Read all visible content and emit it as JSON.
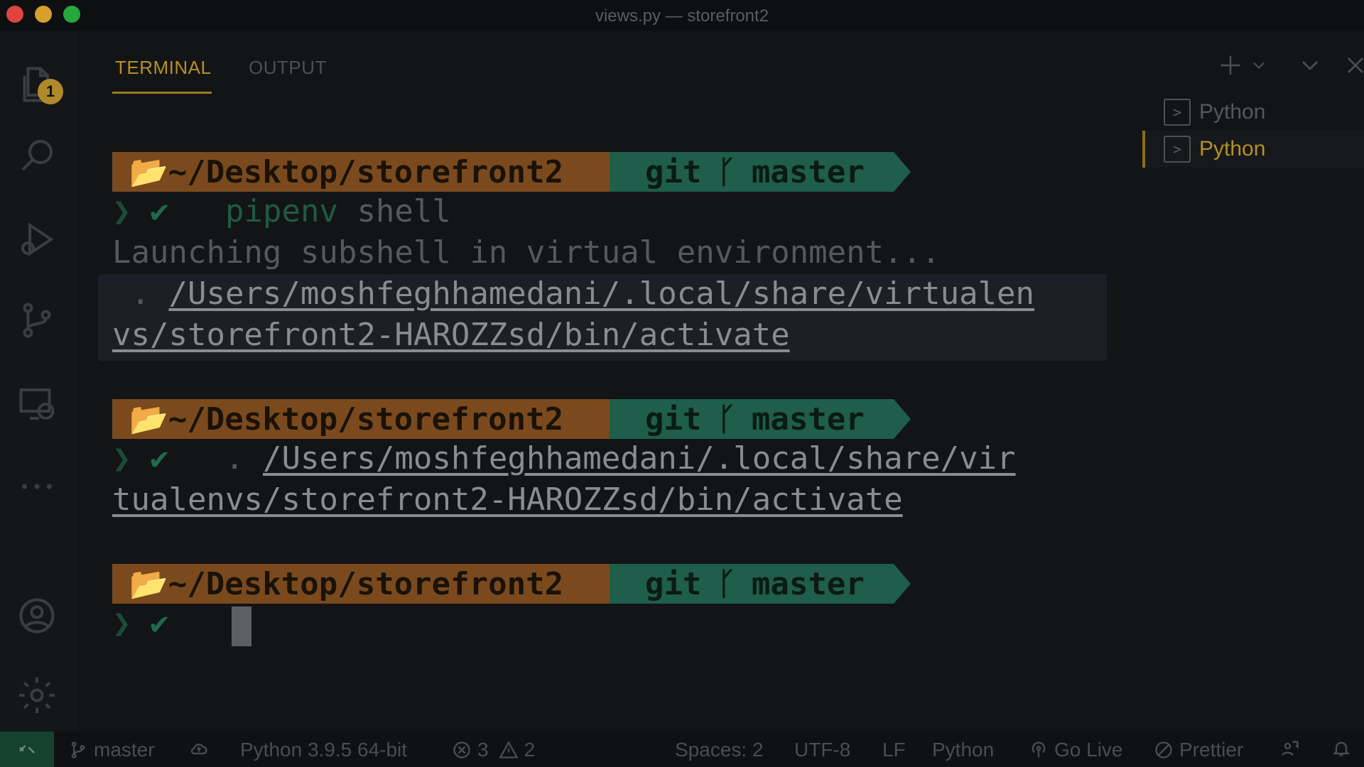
{
  "window": {
    "title": "views.py — storefront2"
  },
  "activity_bar": {
    "explorer_badge": "1"
  },
  "panel": {
    "tabs": [
      {
        "label": "TERMINAL",
        "active": true
      },
      {
        "label": "OUTPUT",
        "active": false
      }
    ],
    "terminals": [
      {
        "label": "Python",
        "active": false
      },
      {
        "label": "Python",
        "active": true
      }
    ]
  },
  "terminal": {
    "prompt": {
      "dir": "~/Desktop/storefront2",
      "git_label": "git",
      "branch": "master"
    },
    "cmd1": {
      "word1": "pipenv",
      "word2": "shell"
    },
    "launching": "Launching subshell in virtual environment...",
    "activate_line1_prefix": " . ",
    "activate_line1_path": "/Users/moshfeghhamedani/.local/share/virtualen",
    "activate_line2_path": "vs/storefront2-HAROZZsd/bin/activate",
    "cmd2_prefix": "  . ",
    "cmd2_path_line1": "/Users/moshfeghhamedani/.local/share/vir",
    "cmd2_path_line2": "tualenvs/storefront2-HAROZZsd/bin/activate"
  },
  "status_bar": {
    "branch": "master",
    "interpreter": "Python 3.9.5 64-bit",
    "errors": "3",
    "warnings": "2",
    "spaces": "Spaces: 2",
    "encoding": "UTF-8",
    "eol": "LF",
    "language": "Python",
    "go_live": "Go Live",
    "prettier": "Prettier"
  },
  "colors": {
    "accent": "#b79024",
    "dir_segment": "#7a4a1e",
    "git_segment": "#1e5e4a"
  }
}
